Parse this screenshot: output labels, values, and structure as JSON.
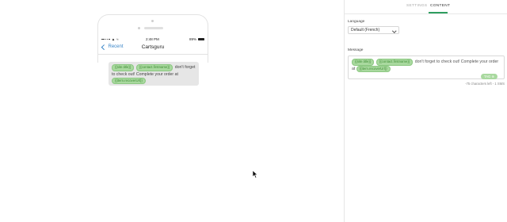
{
  "preview": {
    "status_time": "2:48 PM",
    "battery": "89%",
    "nav_back": "Recent",
    "nav_title": "Cartsguru",
    "tags": [
      "{{site.title}}",
      "{{contact.firstname}}",
      "{{item.recoverUrl}}"
    ],
    "text_1": "don't forget to check out! Complete your order at"
  },
  "panel": {
    "tabs": [
      "SETTINGS",
      "CONTENT"
    ],
    "active_tab": "CONTENT",
    "language_label": "Language",
    "language_value": "Default (French)",
    "message_label": "Message",
    "message_text_1": "don't forget to check out! Complete your order at",
    "tag_button": "TAG ⊕",
    "counter": "-75 characters left - 1 SMS"
  },
  "colors": {
    "accent": "#2f9e60",
    "tag_bg": "#a9d99f",
    "link": "#3a86c8"
  }
}
